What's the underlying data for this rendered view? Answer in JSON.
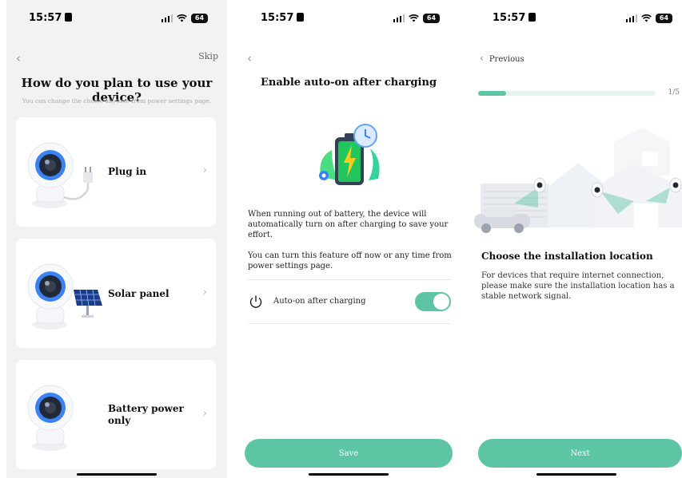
{
  "status_bar": {
    "time": "15:57",
    "battery": "64"
  },
  "screen1": {
    "back_icon": "chevron-left-icon",
    "skip_label": "Skip",
    "title": "How do you plan to use your device?",
    "subtitle": "You can change the choice anytime from power settings page.",
    "options": [
      {
        "label": "Plug in"
      },
      {
        "label": "Solar panel"
      },
      {
        "label": "Battery power only"
      }
    ]
  },
  "screen2": {
    "title": "Enable auto-on after charging",
    "description1": "When running out of battery, the device will automatically turn on after charging to save your effort.",
    "description2": "You can turn this feature off now or any time from power settings page.",
    "toggle_label": "Auto-on after charging",
    "toggle_on": true,
    "save_label": "Save"
  },
  "screen3": {
    "previous_label": "Previous",
    "progress": 0.16,
    "step_label": "1/5",
    "heading": "Choose the installation location",
    "description": "For devices that require internet connection, please make sure the installation location has a stable network signal.",
    "next_label": "Next"
  },
  "colors": {
    "accent": "#5ec5a4",
    "progress_track": "#e1f4ed",
    "camera_blue": "#3b82f6"
  }
}
